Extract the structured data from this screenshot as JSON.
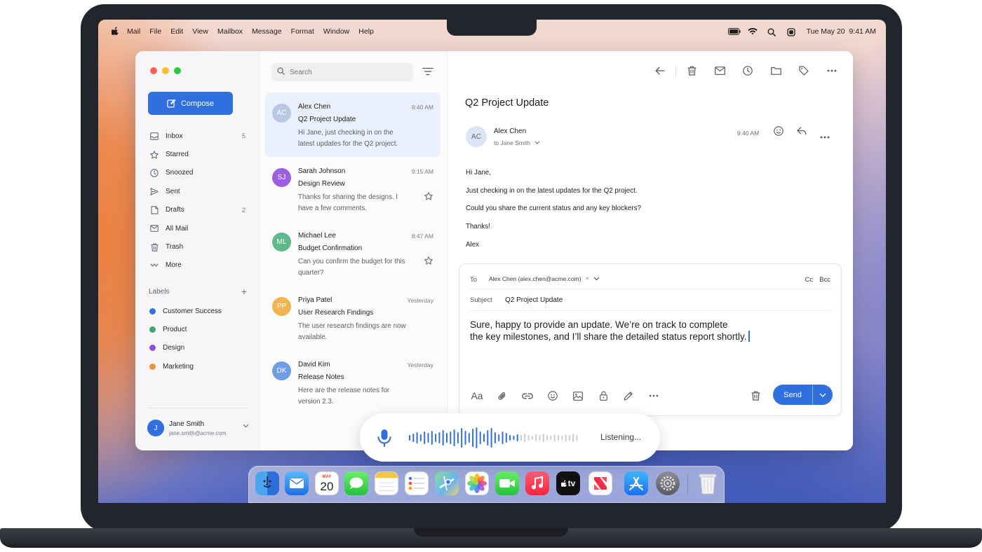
{
  "menubar": {
    "app": "Mail",
    "items": [
      "File",
      "Edit",
      "View",
      "Mailbox",
      "Message",
      "Format",
      "Window",
      "Help"
    ],
    "datetime": "Tue May 20  9:41 AM"
  },
  "sidebar": {
    "compose_label": "Compose",
    "nav": [
      {
        "label": "Inbox",
        "count": "5",
        "icon": "inbox-icon"
      },
      {
        "label": "Starred",
        "count": "",
        "icon": "star-icon"
      },
      {
        "label": "Snoozed",
        "count": "",
        "icon": "clock-icon"
      },
      {
        "label": "Sent",
        "count": "",
        "icon": "send-icon"
      },
      {
        "label": "Drafts",
        "count": "2",
        "icon": "draft-icon"
      },
      {
        "label": "All Mail",
        "count": "",
        "icon": "mail-icon"
      },
      {
        "label": "Trash",
        "count": "",
        "icon": "trash-icon"
      },
      {
        "label": "More",
        "count": "",
        "icon": "more-icon"
      }
    ],
    "labels_heading": "Labels",
    "labels": [
      {
        "label": "Customer Success",
        "color": "#2f6fde"
      },
      {
        "label": "Product",
        "color": "#3fa46a"
      },
      {
        "label": "Design",
        "color": "#8a4fd8"
      },
      {
        "label": "Marketing",
        "color": "#f0923a"
      }
    ],
    "account": {
      "initial": "J",
      "name": "Jane Smith",
      "email": "jane.smith@acme.com"
    }
  },
  "list": {
    "search_placeholder": "Search",
    "messages": [
      {
        "initials": "AC",
        "color": "#b9c8e2",
        "from": "Alex Chen",
        "time": "9:40 AM",
        "subject": "Q2 Project Update",
        "preview": "Hi Jane, just checking in on the latest updates for the Q2 project.",
        "selected": true
      },
      {
        "initials": "SJ",
        "color": "#9b5fe0",
        "from": "Sarah Johnson",
        "time": "9:15 AM",
        "subject": "Design Review",
        "preview": "Thanks for sharing the designs. I have a few comments."
      },
      {
        "initials": "ML",
        "color": "#5fb98a",
        "from": "Michael Lee",
        "time": "8:47 AM",
        "subject": "Budget Confirmation",
        "preview": "Can you confirm the budget for this quarter?"
      },
      {
        "initials": "PP",
        "color": "#f0b550",
        "from": "Priya Patel",
        "time": "Yesterday",
        "subject": "User Research Findings",
        "preview": "The user research findings are now available."
      },
      {
        "initials": "DK",
        "color": "#6f9ee6",
        "from": "David Kim",
        "time": "Yesterday",
        "subject": "Release Notes",
        "preview": "Here are the release notes for version 2.3."
      }
    ]
  },
  "reader": {
    "subject": "Q2 Project Update",
    "sender_initials": "AC",
    "sender": "Alex Chen",
    "to": "to Jane Smith",
    "time": "9:40 AM",
    "body": [
      "Hi Jane,",
      "Just checking in on the latest updates for the Q2 project.",
      "Could you share the current status and any key blockers?",
      "Thanks!",
      "Alex"
    ]
  },
  "composer": {
    "to_label": "To",
    "to_value": "Alex Chen (alex.chen@acme.com)",
    "cc_label": "Cc",
    "bcc_label": "Bcc",
    "subject_label": "Subject",
    "subject_value": "Q2 Project Update",
    "body_line1": "Sure, happy to provide an update. We’re on track to complete",
    "body_line2": "the key milestones, and I’ll share the detailed status report shortly.",
    "format_label": "Aa",
    "send_label": "Send"
  },
  "dictation": {
    "status": "Listening..."
  },
  "dock": {
    "calendar_month": "MAY",
    "calendar_day": "20",
    "tv_label": "tv"
  }
}
